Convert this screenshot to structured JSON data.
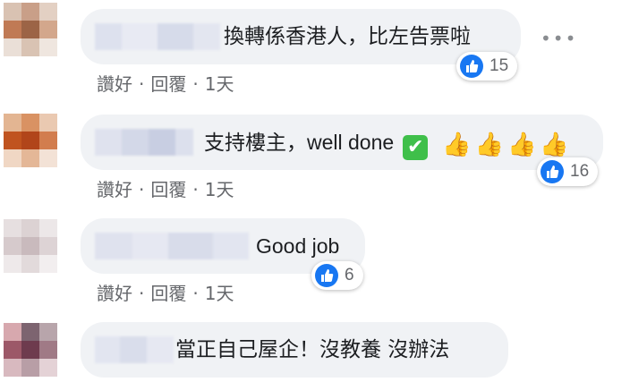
{
  "comments": [
    {
      "text": "換轉係香港人，比左告票啦",
      "likes": "15",
      "actions": [
        "讚好",
        "回覆",
        "1天"
      ]
    },
    {
      "text_cjk": "支持樓主，",
      "text_latin": "well done",
      "likes": "16",
      "actions": [
        "讚好",
        "回覆",
        "1天"
      ]
    },
    {
      "text": "Good job",
      "likes": "6",
      "actions": [
        "讚好",
        "回覆",
        "1天"
      ]
    },
    {
      "text": "當正自己屋企！沒教養 沒辦法"
    }
  ],
  "icons": {
    "more": "more-options-icon",
    "like": "thumbs-up-icon",
    "check": "check-mark-emoji",
    "thumbs": "thumbs-up-emoji"
  },
  "colors": {
    "bubble": "#f0f2f5",
    "like_blue": "#1877f2",
    "meta_gray": "#65676b",
    "check_green": "#3fbf4a"
  }
}
